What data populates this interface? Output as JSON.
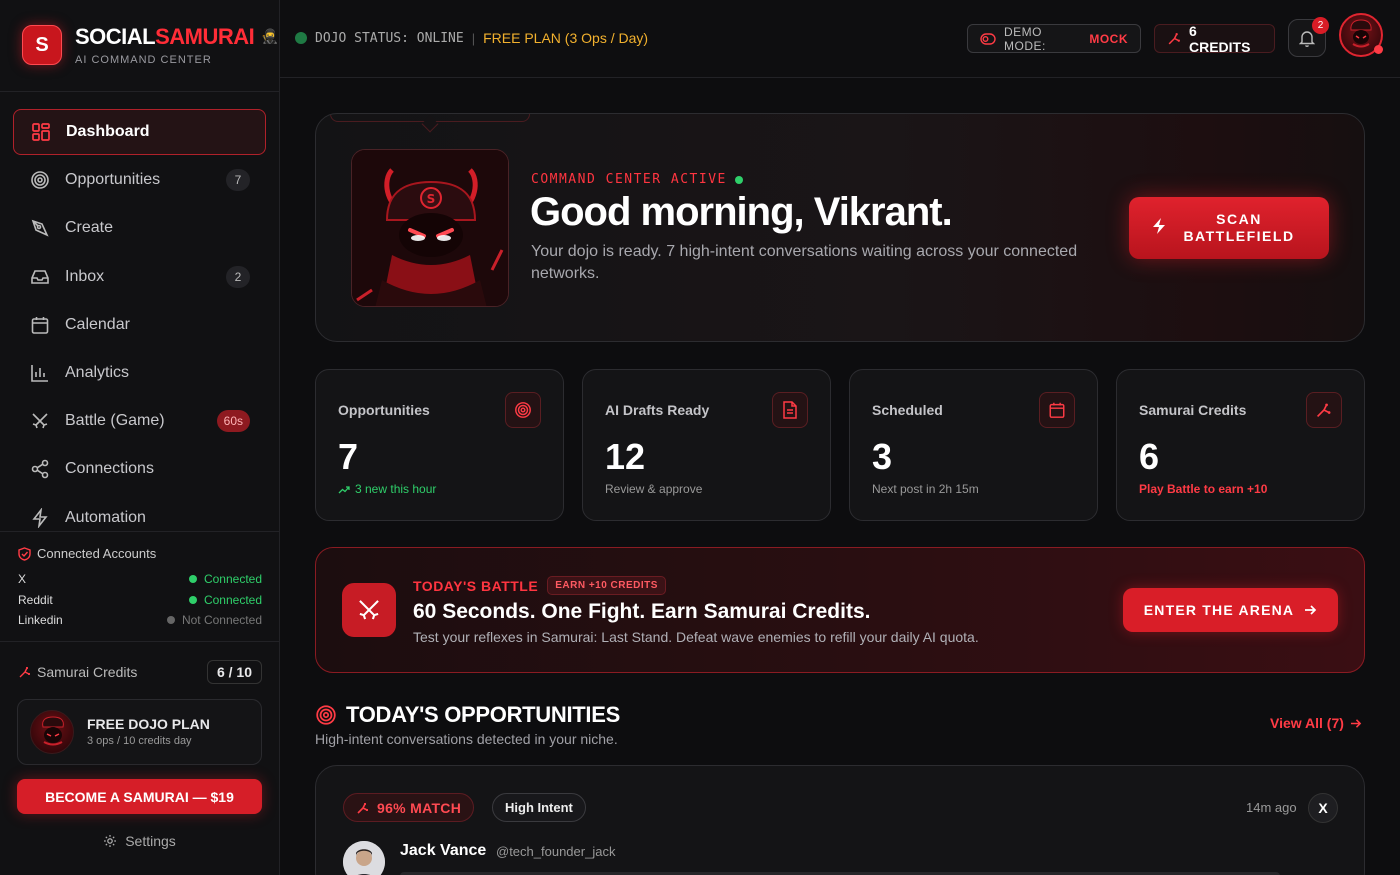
{
  "brand": {
    "name_a": "SOCIAL",
    "name_b": "SAMURAI",
    "subtitle": "AI COMMAND CENTER",
    "logo_letter": "S",
    "ninja": "🥷"
  },
  "sidebar": {
    "items": [
      {
        "label": "Dashboard",
        "icon": "dashboard-icon",
        "badge": ""
      },
      {
        "label": "Opportunities",
        "icon": "target-icon",
        "badge": "7"
      },
      {
        "label": "Create",
        "icon": "pen-icon",
        "badge": ""
      },
      {
        "label": "Inbox",
        "icon": "inbox-icon",
        "badge": "2"
      },
      {
        "label": "Calendar",
        "icon": "calendar-icon",
        "badge": ""
      },
      {
        "label": "Analytics",
        "icon": "chart-icon",
        "badge": ""
      },
      {
        "label": "Battle (Game)",
        "icon": "swords-icon",
        "badge": "60s"
      },
      {
        "label": "Connections",
        "icon": "share-icon",
        "badge": ""
      },
      {
        "label": "Automation",
        "icon": "bolt-icon",
        "badge": ""
      }
    ],
    "accounts_title": "Connected Accounts",
    "accounts": [
      {
        "name": "X",
        "status": "Connected"
      },
      {
        "name": "Reddit",
        "status": "Connected"
      },
      {
        "name": "Linkedin",
        "status": "Not Connected"
      }
    ],
    "credits_label": "Samurai Credits",
    "credits_value": "6 / 10",
    "plan_title": "FREE DOJO PLAN",
    "plan_sub": "3 ops / 10 credits day",
    "upgrade_label": "BECOME A SAMURAI — $19",
    "settings_label": "Settings"
  },
  "topbar": {
    "status_text": "DOJO STATUS: ONLINE",
    "separator": "|",
    "plan_text": "FREE PLAN (3 Ops / Day)",
    "demo_label": "DEMO MODE:",
    "demo_value": "MOCK",
    "credits_label": "6 CREDITS",
    "notif_count": "2"
  },
  "hero": {
    "kicker": "COMMAND CENTER ACTIVE",
    "title": "Good morning, Vikrant.",
    "subtitle": "Your dojo is ready. 7 high-intent conversations waiting across your connected networks.",
    "button_line1": "SCAN",
    "button_line2": "BATTLEFIELD"
  },
  "stats": [
    {
      "label": "Opportunities",
      "value": "7",
      "foot": "3 new this hour",
      "icon": "target-icon"
    },
    {
      "label": "AI Drafts Ready",
      "value": "12",
      "foot": "Review & approve",
      "icon": "document-icon"
    },
    {
      "label": "Scheduled",
      "value": "3",
      "foot": "Next post in 2h 15m",
      "icon": "calendar-icon"
    },
    {
      "label": "Samurai Credits",
      "value": "6",
      "foot": "Play Battle to earn +10",
      "icon": "sparkle-icon"
    }
  ],
  "battle": {
    "kicker": "TODAY'S BATTLE",
    "badge": "EARN +10 CREDITS",
    "title": "60 Seconds. One Fight. Earn Samurai Credits.",
    "subtitle": "Test your reflexes in Samurai: Last Stand. Defeat wave enemies to refill your daily AI quota.",
    "button": "ENTER THE ARENA"
  },
  "opportunities": {
    "title": "TODAY'S OPPORTUNITIES",
    "subtitle": "High-intent conversations detected in your niche.",
    "view_all": "View All (7)",
    "card": {
      "match": "96% MATCH",
      "intent": "High Intent",
      "ago": "14m ago",
      "platform": "X",
      "name": "Jack Vance",
      "handle": "@tech_founder_jack"
    }
  },
  "colors": {
    "accent": "#e0222d",
    "success": "#2fcf6a",
    "warning": "#f2b12e",
    "background": "#0d0d0f"
  }
}
